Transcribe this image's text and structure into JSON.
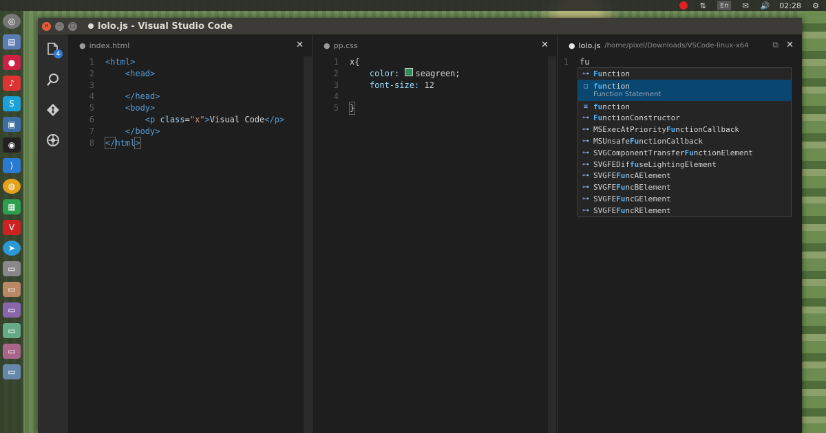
{
  "top_panel": {
    "lang": "En",
    "time": "02:28"
  },
  "window": {
    "title": "lolo.js - Visual Studio Code"
  },
  "activity_bar": {
    "explorer_badge": "4"
  },
  "editors": [
    {
      "tab": "index.html",
      "lines": [
        {
          "n": "1",
          "html": "<html>"
        },
        {
          "n": "2",
          "html": "    <head>"
        },
        {
          "n": "3",
          "html": ""
        },
        {
          "n": "4",
          "html": "    </head>"
        },
        {
          "n": "5",
          "html": "    <body>"
        },
        {
          "n": "6",
          "html": "        <p class=\"x\">Visual Code</p>"
        },
        {
          "n": "7",
          "html": "    </body>"
        },
        {
          "n": "8",
          "html": "</html>"
        }
      ]
    },
    {
      "tab": "pp.css",
      "lines": [
        {
          "n": "1",
          "text": "x{"
        },
        {
          "n": "2",
          "prop": "color:",
          "val": "seagreen;"
        },
        {
          "n": "3",
          "prop": "font-size:",
          "val": "12"
        },
        {
          "n": "4",
          "text": ""
        },
        {
          "n": "5",
          "text": "}"
        }
      ]
    },
    {
      "tab": "lolo.js",
      "path": "/home/pixel/Downloads/VSCode-linux-x64",
      "lines": [
        {
          "n": "1",
          "text": "fu"
        }
      ]
    }
  ],
  "suggest": {
    "items": [
      {
        "label": "Function",
        "match": "Fu",
        "rest": "nction",
        "icon": "⊶"
      },
      {
        "label": "function",
        "match": "fu",
        "rest": "nction",
        "icon": "□",
        "detail": "Function Statement",
        "focused": true
      },
      {
        "label": "function",
        "match": "fu",
        "rest": "nction",
        "icon": "≡"
      },
      {
        "label": "FunctionConstructor",
        "match": "Fu",
        "rest": "nctionConstructor",
        "icon": "⊶"
      },
      {
        "label": "MSExecAtPriorityFunctionCallback",
        "pre": "MSExecAtPriority",
        "match": "Fu",
        "rest": "nctionCallback",
        "icon": "⊶"
      },
      {
        "label": "MSUnsafeFunctionCallback",
        "pre": "MSUnsafe",
        "match": "Fu",
        "rest": "nctionCallback",
        "icon": "⊶"
      },
      {
        "label": "SVGComponentTransferFunctionElement",
        "pre": "SVGComponentTransfer",
        "match": "Fu",
        "rest": "nctionElement",
        "icon": "⊶"
      },
      {
        "label": "SVGFEDiffuseLightingElement",
        "pre": "SVGFEDif",
        "match": "fu",
        "rest": "seLightingElement",
        "icon": "⊶"
      },
      {
        "label": "SVGFEFuncAElement",
        "pre": "SVGFE",
        "match": "Fu",
        "rest": "ncAElement",
        "icon": "⊶"
      },
      {
        "label": "SVGFEFuncBElement",
        "pre": "SVGFE",
        "match": "Fu",
        "rest": "ncBElement",
        "icon": "⊶"
      },
      {
        "label": "SVGFEFuncGElement",
        "pre": "SVGFE",
        "match": "Fu",
        "rest": "ncGElement",
        "icon": "⊶"
      },
      {
        "label": "SVGFEFuncRElement",
        "pre": "SVGFE",
        "match": "Fu",
        "rest": "ncRElement",
        "icon": "⊶"
      }
    ]
  },
  "colors": {
    "accent": "#094771",
    "swatch": "#2e8b57"
  }
}
